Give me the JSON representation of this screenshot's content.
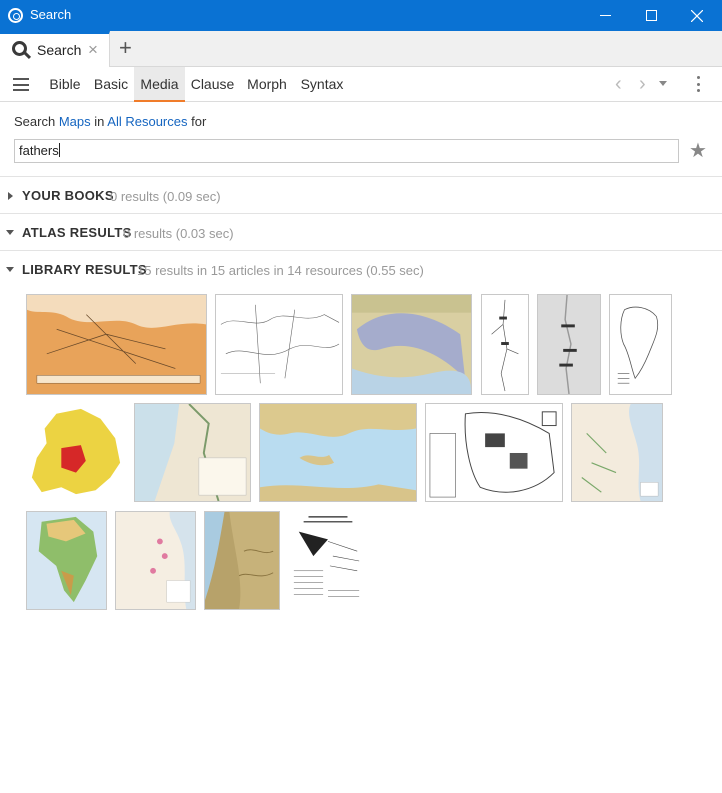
{
  "window": {
    "title": "Search"
  },
  "tabs": [
    {
      "label": "Search",
      "close": "×"
    }
  ],
  "new_tab": "+",
  "search_types": [
    "Bible",
    "Basic",
    "Media",
    "Clause",
    "Morph",
    "Syntax"
  ],
  "active_type": "Media",
  "criteria": {
    "prefix": "Search",
    "kind": "Maps",
    "in": "in",
    "scope": "All Resources",
    "suffix": "for"
  },
  "query": "fathers",
  "sections": [
    {
      "title": "YOUR BOOKS",
      "meta": "0 results (0.09 sec)",
      "expanded": false
    },
    {
      "title": "ATLAS RESULTS",
      "meta": "0 results (0.03 sec)",
      "expanded": false
    },
    {
      "title": "LIBRARY RESULTS",
      "meta": "15 results in 15 articles in 14 resources (0.55 sec)",
      "expanded": true
    }
  ],
  "icons": {
    "app": "search-app-icon",
    "tab": "magnifier-icon",
    "menu": "hamburger-icon",
    "back": "chevron-left-icon",
    "forward": "chevron-right-icon",
    "history": "dropdown-icon",
    "more": "kebab-icon",
    "favorite": "star-icon"
  },
  "colors": {
    "titlebar": "#0a72d3",
    "link": "#1565c0",
    "active_tab_underline": "#f07c2a",
    "muted": "#999999"
  }
}
